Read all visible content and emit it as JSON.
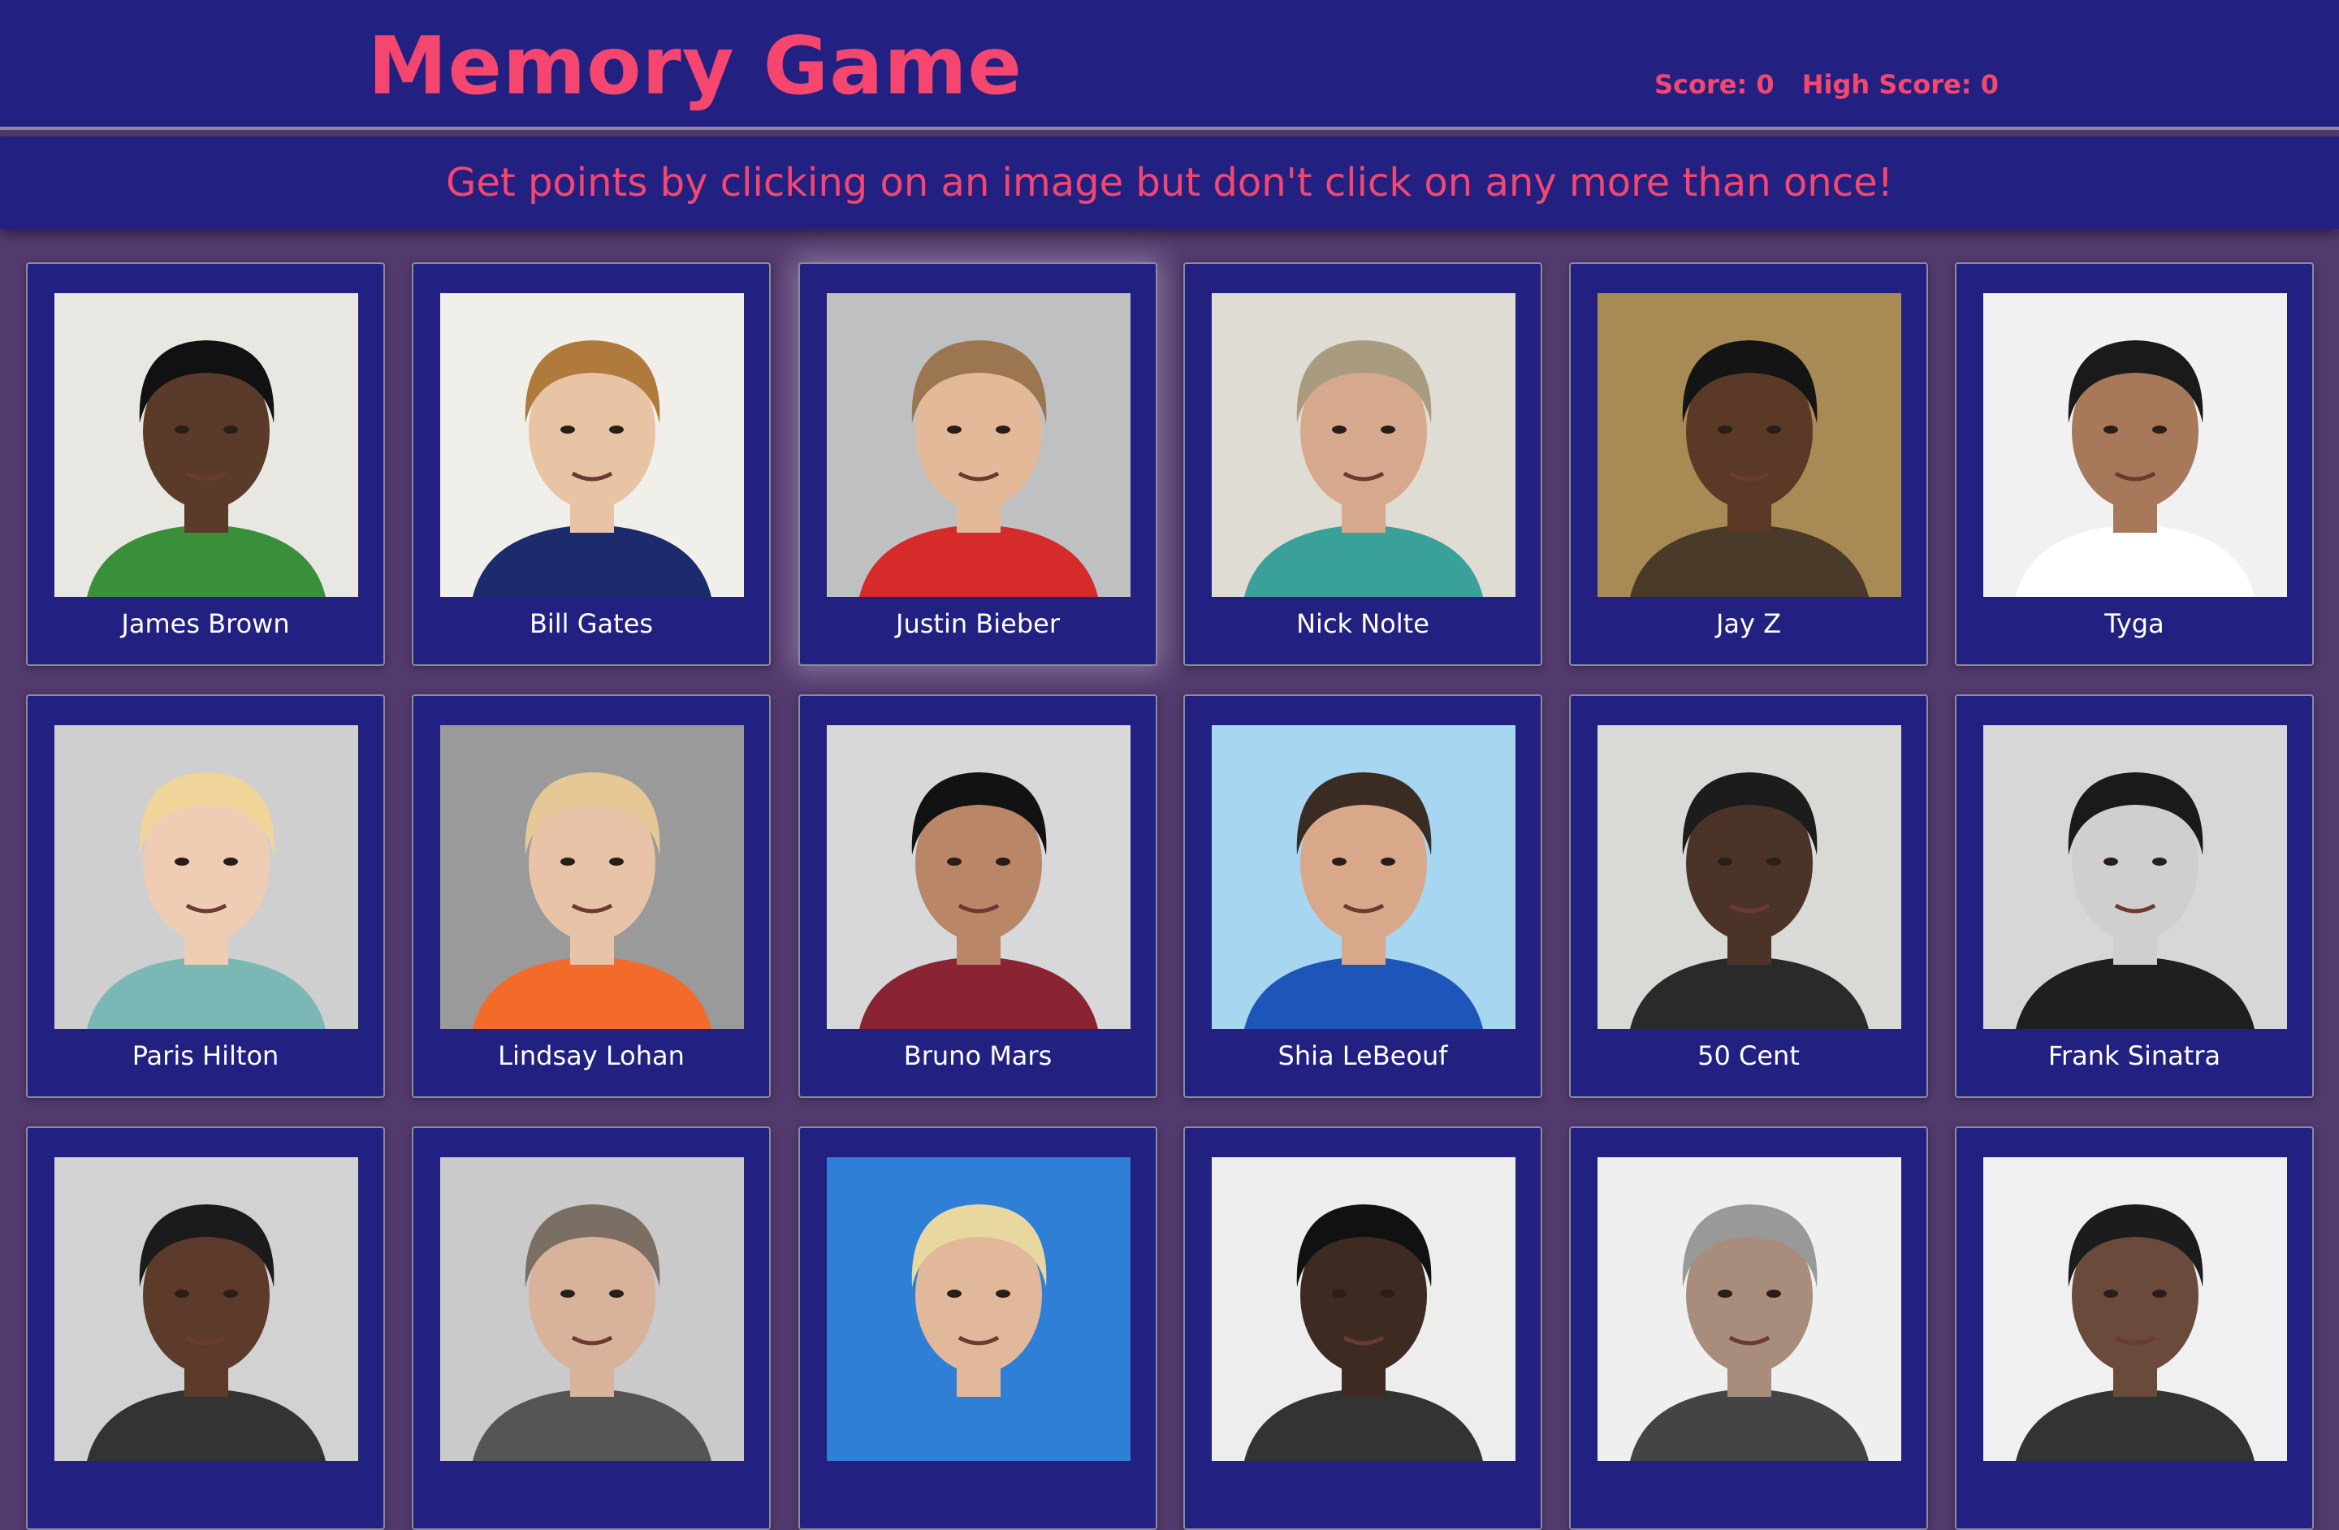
{
  "header": {
    "title": "Memory Game",
    "score_label": "Score: 0",
    "high_score_label": "High Score: 0"
  },
  "instructions": "Get points by clicking on an image but don't click on any more than once!",
  "colors": {
    "accent": "#f5466f",
    "bar": "#222181",
    "background": "#533a6e",
    "card_border": "#8b8aa0"
  },
  "cards": [
    {
      "name": "James Brown",
      "photo_bg": "#e9e7e2",
      "hair": "#111111",
      "skin": "#5a3a28",
      "shirt": "#3a8f3a"
    },
    {
      "name": "Bill Gates",
      "photo_bg": "#f1efe9",
      "hair": "#b07a3c",
      "skin": "#e8c3a4",
      "shirt": "#1c2b6b"
    },
    {
      "name": "Justin Bieber",
      "photo_bg": "#bfc0c2",
      "hair": "#9b7650",
      "skin": "#e3b99a",
      "shirt": "#d62b2b"
    },
    {
      "name": "Nick Nolte",
      "photo_bg": "#dedcd3",
      "hair": "#a99b80",
      "skin": "#d6a98e",
      "shirt": "#3aa19a"
    },
    {
      "name": "Jay Z",
      "photo_bg": "#a88a55",
      "hair": "#141414",
      "skin": "#5a3a26",
      "shirt": "#4a3a2a"
    },
    {
      "name": "Tyga",
      "photo_bg": "#f1f1f1",
      "hair": "#1a1a1a",
      "skin": "#a8785a",
      "shirt": "#ffffff"
    },
    {
      "name": "Paris Hilton",
      "photo_bg": "#cfcfcf",
      "hair": "#f0d59a",
      "skin": "#efcdb4",
      "shirt": "#7bb8b5"
    },
    {
      "name": "Lindsay Lohan",
      "photo_bg": "#9a9a9a",
      "hair": "#e6c896",
      "skin": "#e9c3a8",
      "shirt": "#f26b2a"
    },
    {
      "name": "Bruno Mars",
      "photo_bg": "#d8d8da",
      "hair": "#121212",
      "skin": "#b98767",
      "shirt": "#8a2432"
    },
    {
      "name": "Shia LeBeouf",
      "photo_bg": "#a7d6f0",
      "hair": "#3a2c22",
      "skin": "#d9a78a",
      "shirt": "#1e55b8"
    },
    {
      "name": "50 Cent",
      "photo_bg": "#d9d9d5",
      "hair": "#1c1c1c",
      "skin": "#4b3328",
      "shirt": "#2a2a2a"
    },
    {
      "name": "Frank Sinatra",
      "photo_bg": "#d7d7d7",
      "hair": "#1a1a1a",
      "skin": "#cfcfcf",
      "shirt": "#1f1f1f"
    },
    {
      "name": "",
      "photo_bg": "#d2d2d2",
      "hair": "#1b1b1b",
      "skin": "#5c3b2a",
      "shirt": "#333333"
    },
    {
      "name": "",
      "photo_bg": "#cacaca",
      "hair": "#7b6f63",
      "skin": "#d8b29a",
      "shirt": "#555555"
    },
    {
      "name": "",
      "photo_bg": "#2f7fd6",
      "hair": "#e8d8a0",
      "skin": "#e2b89a",
      "shirt": "#2f7fd6"
    },
    {
      "name": "",
      "photo_bg": "#ededed",
      "hair": "#111111",
      "skin": "#3d2a20",
      "shirt": "#333333"
    },
    {
      "name": "",
      "photo_bg": "#efefef",
      "hair": "#999999",
      "skin": "#a88c7c",
      "shirt": "#444444"
    },
    {
      "name": "",
      "photo_bg": "#f0f0f0",
      "hair": "#1c1c1c",
      "skin": "#6a4a3a",
      "shirt": "#333333"
    }
  ]
}
